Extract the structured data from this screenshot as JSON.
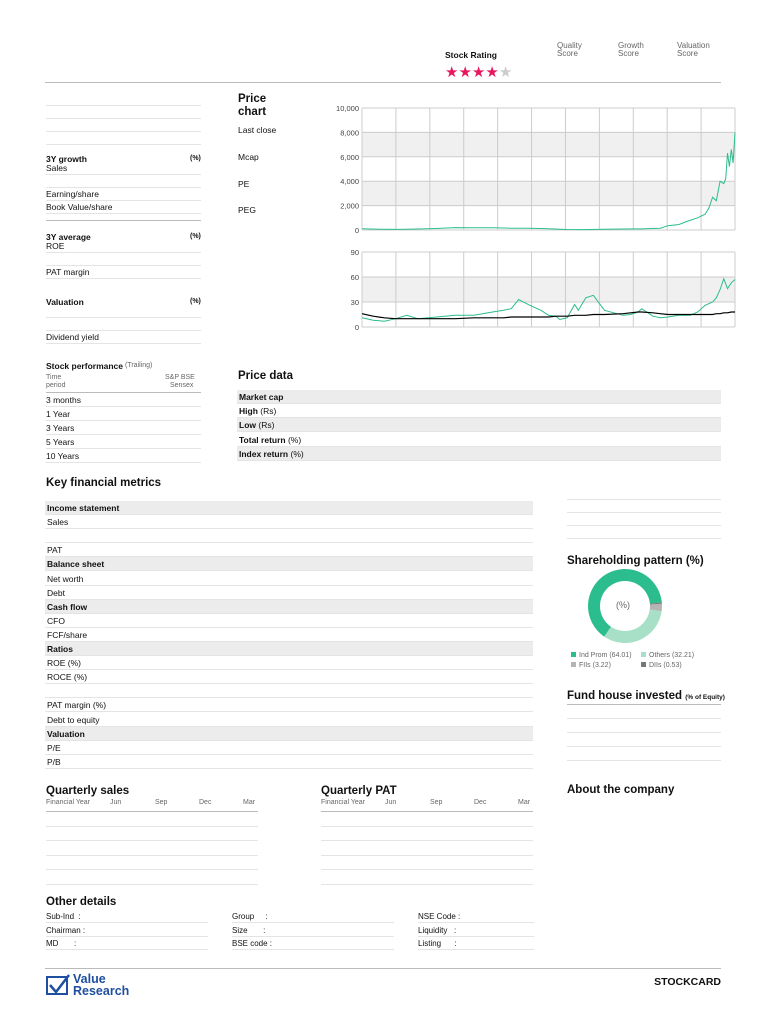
{
  "header": {
    "stock_rating_label": "Stock Rating",
    "rating": 4,
    "rating_max": 5,
    "quality_score": [
      "Quality",
      "Score"
    ],
    "growth_score": [
      "Growth",
      "Score"
    ],
    "valuation_score": [
      "Valuation",
      "Score"
    ],
    "star_color": "#e8185f"
  },
  "left": {
    "growth": {
      "title": "3Y growth",
      "unit": "(%)",
      "rows": [
        "Sales",
        "",
        "Earning/share",
        "Book Value/share"
      ]
    },
    "average": {
      "title": "3Y average",
      "unit": "(%)",
      "rows": [
        "ROE",
        "",
        "PAT margin"
      ]
    },
    "valuation": {
      "title": "Valuation",
      "unit": "(%)",
      "rows": [
        "",
        "",
        "Dividend yield"
      ]
    },
    "performance": {
      "title": "Stock performance",
      "note": "(Trailing)",
      "col1": [
        "Time",
        "period"
      ],
      "col2": [
        "S&P BSE",
        "Sensex"
      ],
      "rows": [
        "3 months",
        "1 Year",
        "3 Years",
        "5 Years",
        "10 Years"
      ]
    }
  },
  "price_chart": {
    "title": [
      "Price",
      "chart"
    ],
    "labels": [
      "Last close",
      "Mcap",
      "PE",
      "PEG"
    ]
  },
  "price_data": {
    "title": "Price data",
    "rows": [
      [
        "Market cap",
        ""
      ],
      [
        "High",
        " (Rs)"
      ],
      [
        "Low",
        " (Rs)"
      ],
      [
        "Total return",
        " (%)"
      ],
      [
        "Index return",
        " (%)"
      ]
    ]
  },
  "key_metrics": {
    "title": "Key financial metrics",
    "rows": [
      {
        "label": "Income statement",
        "section": true
      },
      {
        "label": "Sales"
      },
      {
        "label": ""
      },
      {
        "label": "PAT"
      },
      {
        "label": "Balance sheet",
        "section": true
      },
      {
        "label": "Net worth"
      },
      {
        "label": "Debt"
      },
      {
        "label": "Cash flow",
        "section": true
      },
      {
        "label": "CFO"
      },
      {
        "label": "FCF/share"
      },
      {
        "label": "Ratios",
        "section": true
      },
      {
        "label": "ROE (%)"
      },
      {
        "label": "ROCE (%)"
      },
      {
        "label": ""
      },
      {
        "label": "PAT margin (%)"
      },
      {
        "label": "Debt to equity"
      },
      {
        "label": "Valuation",
        "section": true
      },
      {
        "label": "P/E"
      },
      {
        "label": "P/B"
      }
    ]
  },
  "shareholding": {
    "title": "Shareholding pattern (%)",
    "center": "(%)",
    "slices": [
      {
        "name": "Ind Prom",
        "value": 64.01,
        "color": "#2bbd8e"
      },
      {
        "name": "Others",
        "value": 32.21,
        "color": "#a7dfc7"
      },
      {
        "name": "FIIs",
        "value": 3.22,
        "color": "#b5b5b5"
      },
      {
        "name": "DIIs",
        "value": 0.53,
        "color": "#777777"
      }
    ],
    "legend": [
      "Ind Prom (64.01)",
      "Others (32.21)",
      "FIIs (3.22)",
      "DIIs (0.53)"
    ]
  },
  "fund_house": {
    "title": "Fund house invested",
    "note": "(% of Equity)"
  },
  "about": {
    "title": "About the company"
  },
  "quarterly_sales": {
    "title": "Quarterly sales",
    "cols": [
      "Financial Year",
      "Jun",
      "Sep",
      "Dec",
      "Mar"
    ]
  },
  "quarterly_pat": {
    "title": "Quarterly  PAT",
    "cols": [
      "Financial Year",
      "Jun",
      "Sep",
      "Dec",
      "Mar"
    ]
  },
  "other_details": {
    "title": "Other details",
    "cols": [
      [
        "Sub-Ind",
        ":",
        "Chairman :",
        "MD",
        ":"
      ],
      [
        "Group",
        ":",
        "Size",
        ":",
        "BSE code :"
      ],
      [
        "NSE Code :",
        "",
        "Liquidity",
        ":",
        "Listing"
      ]
    ],
    "items": [
      [
        "Sub-Ind  :",
        "Chairman :",
        "MD       :"
      ],
      [
        "Group     :",
        "Size       :",
        "BSE code :"
      ],
      [
        "NSE Code :",
        "Liquidity   :",
        "Listing      :"
      ]
    ]
  },
  "footer": {
    "logo": [
      "Value",
      "Research"
    ],
    "label": "STOCKCARD"
  },
  "chart_data": [
    {
      "type": "line",
      "title": "Price",
      "ylim": [
        0,
        10000
      ],
      "yticks": [
        "10,000",
        "8,000",
        "6,000",
        "4,000",
        "2,000",
        "0"
      ],
      "x": [
        0,
        0.05,
        0.1,
        0.15,
        0.2,
        0.25,
        0.3,
        0.35,
        0.4,
        0.45,
        0.5,
        0.55,
        0.6,
        0.65,
        0.7,
        0.75,
        0.8,
        0.82,
        0.85,
        0.87,
        0.9,
        0.92,
        0.93,
        0.94,
        0.95,
        0.96,
        0.97,
        0.975,
        0.98,
        0.985,
        0.99,
        0.995,
        1
      ],
      "series": [
        {
          "name": "Price",
          "color": "#2bbd8e",
          "values": [
            100,
            60,
            50,
            80,
            120,
            200,
            180,
            180,
            150,
            150,
            100,
            40,
            30,
            60,
            80,
            90,
            150,
            350,
            450,
            700,
            1000,
            1300,
            1800,
            2700,
            2400,
            4000,
            3800,
            4200,
            6300,
            5200,
            6600,
            5500,
            8000
          ]
        }
      ]
    },
    {
      "type": "line",
      "title": "Relative",
      "ylim": [
        0,
        90
      ],
      "yticks": [
        "90",
        "60",
        "30",
        "0"
      ],
      "x": [
        0,
        0.03,
        0.06,
        0.09,
        0.12,
        0.15,
        0.2,
        0.25,
        0.3,
        0.35,
        0.38,
        0.4,
        0.42,
        0.45,
        0.48,
        0.5,
        0.52,
        0.53,
        0.55,
        0.57,
        0.58,
        0.6,
        0.62,
        0.65,
        0.7,
        0.72,
        0.74,
        0.75,
        0.78,
        0.8,
        0.82,
        0.85,
        0.88,
        0.9,
        0.92,
        0.94,
        0.95,
        0.96,
        0.97,
        0.98,
        0.99,
        1
      ],
      "series": [
        {
          "name": "Stock",
          "color": "#2bbd8e",
          "values": [
            11,
            8,
            7,
            10,
            14,
            10,
            12,
            14,
            14,
            18,
            20,
            22,
            33,
            26,
            20,
            14,
            13,
            9,
            11,
            27,
            20,
            35,
            38,
            20,
            14,
            15,
            18,
            22,
            13,
            11,
            12,
            14,
            14,
            18,
            26,
            30,
            35,
            45,
            58,
            46,
            53,
            57
          ]
        },
        {
          "name": "Index",
          "color": "#000000",
          "values": [
            16,
            13,
            11,
            10,
            10,
            10,
            10,
            10,
            11,
            11,
            11,
            12,
            12,
            12,
            12,
            12,
            13,
            13,
            13,
            14,
            14,
            14,
            15,
            15,
            16,
            17,
            18,
            18,
            17,
            16,
            15,
            15,
            15,
            15,
            15,
            15,
            16,
            16,
            17,
            17,
            18,
            18
          ]
        }
      ]
    }
  ]
}
